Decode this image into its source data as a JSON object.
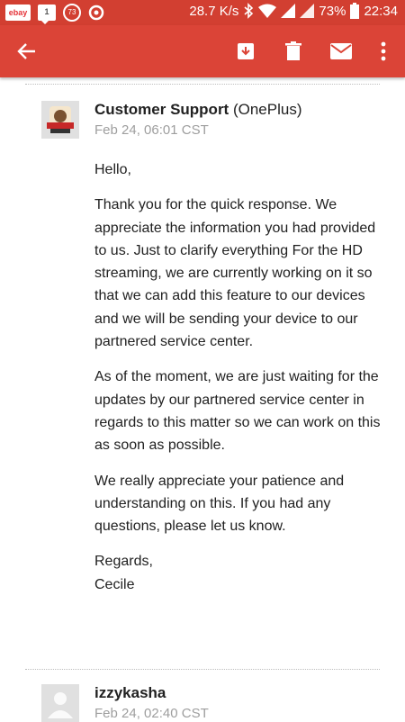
{
  "status_bar": {
    "ebay_label": "ebay",
    "msg_count": "1",
    "circle_count": "73",
    "net_speed": "28.7 K/s",
    "battery": "73%",
    "time": "22:34"
  },
  "toolbar": {
    "back": "arrow-left-icon",
    "archive": "archive-icon",
    "delete": "trash-icon",
    "mark_unread": "mail-icon",
    "more": "more-vert-icon"
  },
  "messages": [
    {
      "sender_name": "Customer Support",
      "sender_org": "(OnePlus)",
      "date": "Feb 24, 06:01 CST",
      "paragraphs": [
        "Hello,",
        "Thank you for the quick response. We appreciate the information you had provided to us. Just to clarify everything For the HD streaming, we are currently working on it so that we can add this feature to our devices and we will be sending your device to our partnered service center.",
        "As of the moment, we are just waiting for the updates by our partnered service center in regards to this matter so we can work on this as soon as possible.",
        "We really appreciate your patience and understanding on this. If you had any questions, please let us know.",
        "Regards,\nCecile"
      ]
    },
    {
      "sender_name": "izzykasha",
      "date": "Feb 24, 02:40 CST"
    }
  ],
  "colors": {
    "status_bar": "#d23f31",
    "app_bar": "#db4437"
  }
}
